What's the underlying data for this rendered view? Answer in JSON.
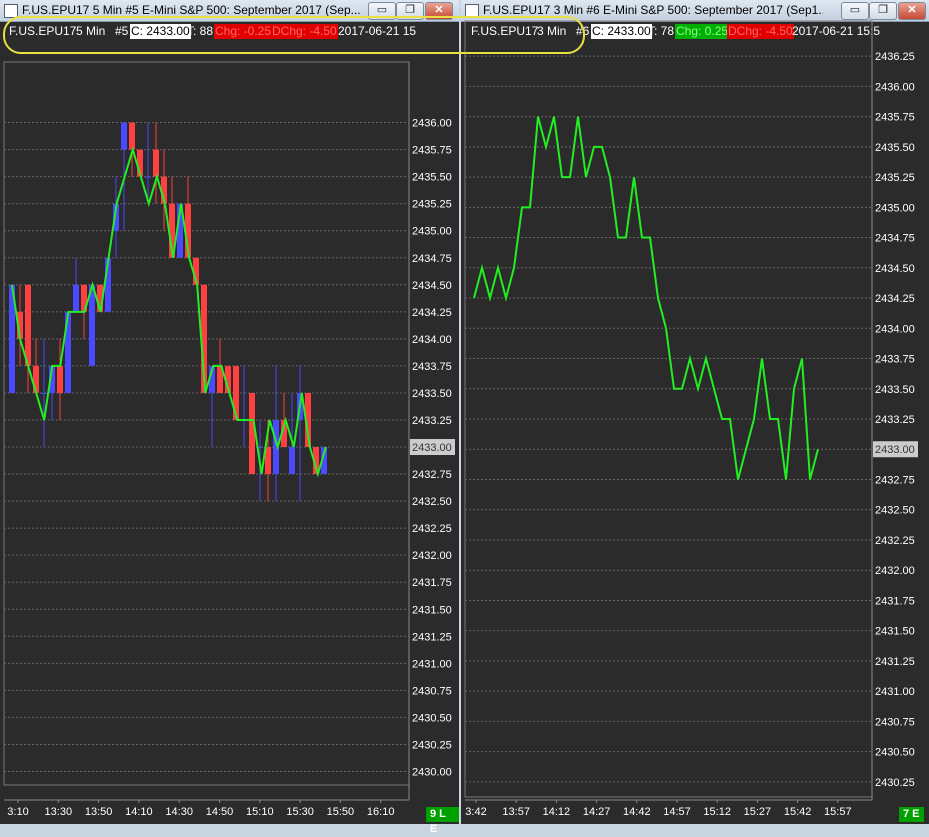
{
  "left": {
    "title": "F.US.EPU17  5 Min   #5  E-Mini S&P 500: September 2017 (Sep...",
    "info": {
      "symbol": "F.US.EPU17",
      "interval": "5 Min",
      "chart_no": "#5",
      "close": "C: 2433.00",
      "trades": "T: 88",
      "chg": "Chg: -0.25",
      "dchg": "DChg: -4.50",
      "datetime": "2017-06-21 15"
    },
    "corner": "9 L E",
    "price_label": "2433.00",
    "colors": {
      "up": "#4a4aff",
      "down": "#ff4040",
      "line": "#22ee22"
    },
    "chart_data": {
      "type": "candlestick",
      "ylim": [
        2429.875,
        2436.375
      ],
      "yticks": [
        "2436.00",
        "2435.75",
        "2435.50",
        "2435.25",
        "2435.00",
        "2434.75",
        "2434.50",
        "2434.25",
        "2434.00",
        "2433.75",
        "2433.50",
        "2433.25",
        "2433.00",
        "2432.75",
        "2432.50",
        "2432.25",
        "2432.00",
        "2431.75",
        "2431.50",
        "2431.25",
        "2431.00",
        "2430.75",
        "2430.50",
        "2430.25",
        "2430.00"
      ],
      "xticks": [
        "3:10",
        "13:30",
        "13:50",
        "14:10",
        "14:30",
        "14:50",
        "15:10",
        "15:30",
        "15:50",
        "16:10"
      ],
      "candles": [
        {
          "o": 2433.5,
          "h": 2434.5,
          "l": 2433.5,
          "c": 2434.5
        },
        {
          "o": 2434.25,
          "h": 2434.5,
          "l": 2433.75,
          "c": 2434.0
        },
        {
          "o": 2434.5,
          "h": 2434.5,
          "l": 2433.5,
          "c": 2433.75
        },
        {
          "o": 2433.75,
          "h": 2434.0,
          "l": 2433.5,
          "c": 2433.5
        },
        {
          "o": 2433.5,
          "h": 2434.0,
          "l": 2433.0,
          "c": 2433.5
        },
        {
          "o": 2433.5,
          "h": 2433.75,
          "l": 2433.25,
          "c": 2433.75
        },
        {
          "o": 2433.75,
          "h": 2434.0,
          "l": 2433.25,
          "c": 2433.5
        },
        {
          "o": 2433.5,
          "h": 2434.25,
          "l": 2433.5,
          "c": 2434.25
        },
        {
          "o": 2434.25,
          "h": 2434.75,
          "l": 2434.25,
          "c": 2434.5
        },
        {
          "o": 2434.5,
          "h": 2434.5,
          "l": 2434.0,
          "c": 2434.25
        },
        {
          "o": 2433.75,
          "h": 2434.5,
          "l": 2433.75,
          "c": 2434.5
        },
        {
          "o": 2434.5,
          "h": 2434.5,
          "l": 2434.25,
          "c": 2434.25
        },
        {
          "o": 2434.25,
          "h": 2434.75,
          "l": 2434.25,
          "c": 2434.75
        },
        {
          "o": 2435.0,
          "h": 2435.5,
          "l": 2434.75,
          "c": 2435.25
        },
        {
          "o": 2435.75,
          "h": 2436.0,
          "l": 2435.0,
          "c": 2436.0
        },
        {
          "o": 2436.0,
          "h": 2436.0,
          "l": 2435.5,
          "c": 2435.75
        },
        {
          "o": 2435.75,
          "h": 2435.75,
          "l": 2435.5,
          "c": 2435.5
        },
        {
          "o": 2435.5,
          "h": 2436.0,
          "l": 2435.25,
          "c": 2435.5
        },
        {
          "o": 2435.75,
          "h": 2436.0,
          "l": 2435.25,
          "c": 2435.5
        },
        {
          "o": 2435.5,
          "h": 2435.75,
          "l": 2435.0,
          "c": 2435.25
        },
        {
          "o": 2435.25,
          "h": 2435.5,
          "l": 2434.75,
          "c": 2434.75
        },
        {
          "o": 2434.75,
          "h": 2435.25,
          "l": 2434.75,
          "c": 2435.25
        },
        {
          "o": 2435.25,
          "h": 2435.5,
          "l": 2434.75,
          "c": 2434.75
        },
        {
          "o": 2434.75,
          "h": 2434.75,
          "l": 2434.5,
          "c": 2434.5
        },
        {
          "o": 2434.5,
          "h": 2434.5,
          "l": 2433.5,
          "c": 2433.5
        },
        {
          "o": 2433.5,
          "h": 2433.75,
          "l": 2433.0,
          "c": 2433.75
        },
        {
          "o": 2433.75,
          "h": 2434.0,
          "l": 2433.5,
          "c": 2433.5
        },
        {
          "o": 2433.75,
          "h": 2433.75,
          "l": 2433.5,
          "c": 2433.5
        },
        {
          "o": 2433.75,
          "h": 2433.75,
          "l": 2433.25,
          "c": 2433.25
        },
        {
          "o": 2433.25,
          "h": 2433.75,
          "l": 2433.0,
          "c": 2433.25
        },
        {
          "o": 2433.5,
          "h": 2433.5,
          "l": 2432.75,
          "c": 2432.75
        },
        {
          "o": 2433.0,
          "h": 2433.25,
          "l": 2432.5,
          "c": 2433.0
        },
        {
          "o": 2433.0,
          "h": 2433.25,
          "l": 2432.5,
          "c": 2432.75
        },
        {
          "o": 2432.75,
          "h": 2433.75,
          "l": 2432.5,
          "c": 2433.25
        },
        {
          "o": 2433.25,
          "h": 2433.5,
          "l": 2433.0,
          "c": 2433.0
        },
        {
          "o": 2432.75,
          "h": 2433.5,
          "l": 2432.75,
          "c": 2433.0
        },
        {
          "o": 2433.25,
          "h": 2433.75,
          "l": 2432.5,
          "c": 2433.5
        },
        {
          "o": 2433.5,
          "h": 2433.5,
          "l": 2433.0,
          "c": 2433.0
        },
        {
          "o": 2433.0,
          "h": 2433.0,
          "l": 2432.75,
          "c": 2432.75
        },
        {
          "o": 2432.75,
          "h": 2433.0,
          "l": 2432.75,
          "c": 2433.0
        }
      ],
      "line": [
        2434.5,
        2434.0,
        2433.75,
        2433.5,
        2433.25,
        2433.75,
        2433.75,
        2434.25,
        2434.25,
        2434.25,
        2434.5,
        2434.25,
        2434.75,
        2435.25,
        2435.5,
        2435.75,
        2435.5,
        2435.25,
        2435.5,
        2435.25,
        2434.75,
        2435.25,
        2434.75,
        2434.5,
        2433.5,
        2433.75,
        2433.75,
        2433.5,
        2433.25,
        2433.25,
        2433.25,
        2432.75,
        2433.25,
        2433.0,
        2433.25,
        2433.0,
        2433.5,
        2433.0,
        2432.75,
        2433.0
      ]
    }
  },
  "right": {
    "title": "F.US.EPU17  3 Min   #6  E-Mini S&P 500: September 2017 (Sep1...",
    "info": {
      "symbol": "F.US.EPU17",
      "interval": "3 Min",
      "chart_no": "#6",
      "close": "C: 2433.00",
      "trades": "T: 78",
      "chg": "Chg: 0.25",
      "dchg": "DChg: -4.50",
      "datetime": "2017-06-21 15:5"
    },
    "corner": "7 E",
    "price_label": "2433.00",
    "colors": {
      "line": "#22ee22"
    },
    "chart_data": {
      "type": "line",
      "ylim": [
        2430.125,
        2436.375
      ],
      "yticks": [
        "2436.25",
        "2436.00",
        "2435.75",
        "2435.50",
        "2435.25",
        "2435.00",
        "2434.75",
        "2434.50",
        "2434.25",
        "2434.00",
        "2433.75",
        "2433.50",
        "2433.25",
        "2433.00",
        "2432.75",
        "2432.50",
        "2432.25",
        "2432.00",
        "2431.75",
        "2431.50",
        "2431.25",
        "2431.00",
        "2430.75",
        "2430.50",
        "2430.25"
      ],
      "xticks": [
        "3:42",
        "13:57",
        "14:12",
        "14:27",
        "14:42",
        "14:57",
        "15:12",
        "15:27",
        "15:42",
        "15:57"
      ],
      "values": [
        2434.25,
        2434.5,
        2434.25,
        2434.5,
        2434.25,
        2434.5,
        2435.0,
        2435.0,
        2435.75,
        2435.5,
        2435.75,
        2435.25,
        2435.25,
        2435.75,
        2435.25,
        2435.5,
        2435.5,
        2435.25,
        2434.75,
        2434.75,
        2435.25,
        2434.75,
        2434.75,
        2434.25,
        2434.0,
        2433.5,
        2433.5,
        2433.75,
        2433.5,
        2433.75,
        2433.5,
        2433.25,
        2433.25,
        2432.75,
        2433.0,
        2433.25,
        2433.75,
        2433.25,
        2433.25,
        2432.75,
        2433.5,
        2433.75,
        2432.75,
        2433.0
      ]
    }
  }
}
